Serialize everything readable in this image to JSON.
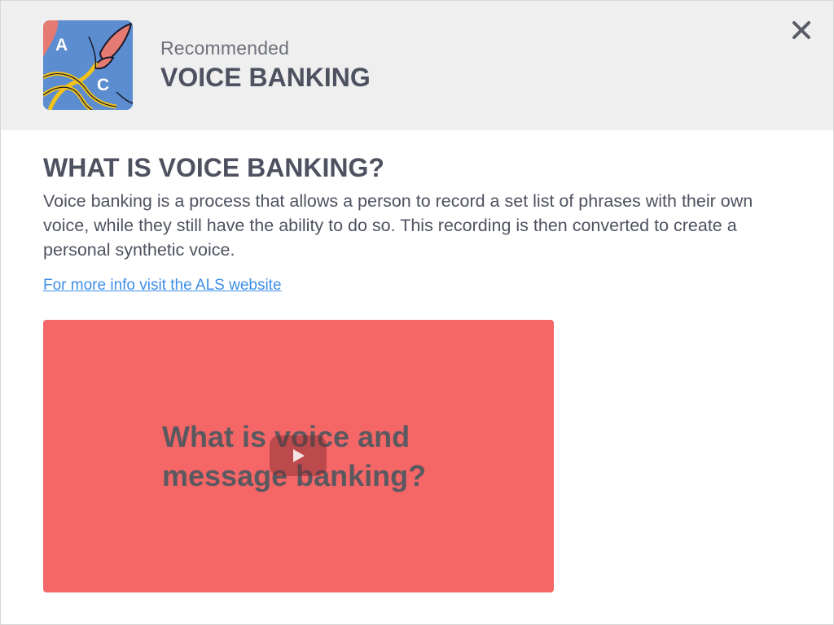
{
  "header": {
    "icon_letters": [
      "A",
      "C"
    ],
    "eyebrow": "Recommended",
    "title": "VOICE BANKING",
    "close_icon": "close-icon"
  },
  "content": {
    "heading": "WHAT IS VOICE BANKING?",
    "body": "Voice banking is a process that allows a person to record a set list of phrases with their own voice, while they still have the ability to do so. This recording is then converted to create a personal synthetic voice.",
    "link_text": "For more info visit the ALS website"
  },
  "video": {
    "title": "What is voice and message banking?",
    "play_icon": "play-icon"
  },
  "colors": {
    "header_bg": "#efefef",
    "text_dark": "#4e5260",
    "link": "#3d8ee8",
    "video_bg": "#f56667",
    "icon_bg": "#5b8dd0"
  }
}
